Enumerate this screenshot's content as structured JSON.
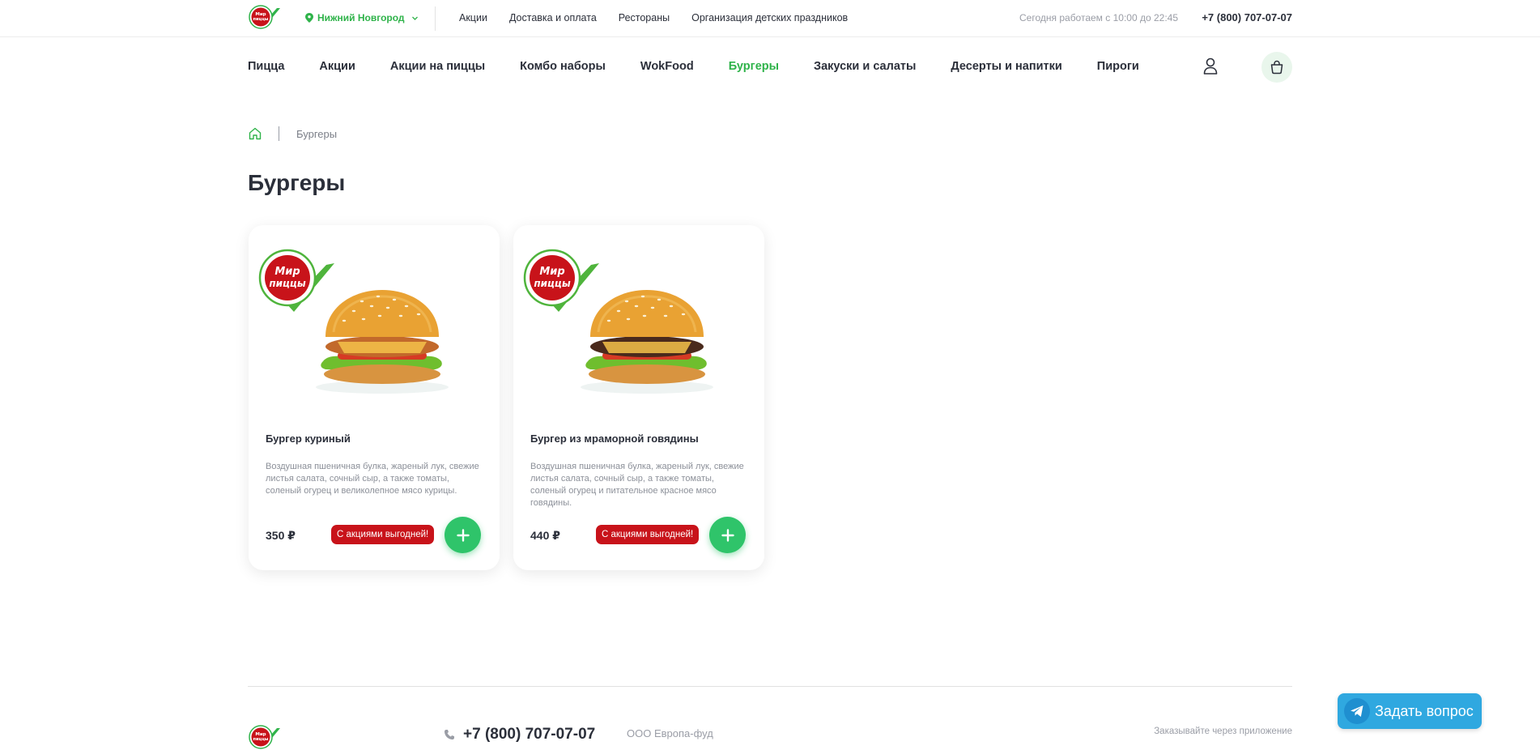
{
  "brand": {
    "logo_text_1": "Мир",
    "logo_text_2": "пиццы",
    "red": "#c8131a",
    "green": "#2fb34a"
  },
  "topbar": {
    "city": "Нижний Новгород",
    "links": [
      "Акции",
      "Доставка и оплата",
      "Рестораны",
      "Организация детских праздников"
    ],
    "hours": "Сегодня работаем с 10:00 до 22:45",
    "phone": "+7 (800) 707-07-07"
  },
  "mainnav": {
    "items": [
      "Пицца",
      "Акции",
      "Акции на пиццы",
      "Комбо наборы",
      "WokFood",
      "Бургеры",
      "Закуски и салаты",
      "Десерты и напитки",
      "Пироги"
    ],
    "active_index": 5
  },
  "breadcrumb": {
    "current": "Бургеры"
  },
  "page": {
    "title": "Бургеры"
  },
  "products": [
    {
      "name": "Бургер куриный",
      "description": "Воздушная пшеничная булка, жареный лук, свежие листья салата, сочный сыр, а также томаты, соленый огурец и великолепное мясо курицы.",
      "price": "350 ₽",
      "promo": "С акциями выгодней!",
      "patty_color": "#c2692b"
    },
    {
      "name": "Бургер из мраморной говядины",
      "description": "Воздушная пшеничная булка, жареный лук, свежие листья салата, сочный сыр, а также томаты, соленый огурец и питательное красное мясо говядины.",
      "price": "440 ₽",
      "promo": "С акциями выгодней!",
      "patty_color": "#4a2a1c"
    }
  ],
  "footer": {
    "phone": "+7 (800) 707-07-07",
    "company": "ООО Европа-фуд",
    "app_text": "Заказывайте через приложение"
  },
  "ask_button": {
    "label": "Задать вопрос"
  }
}
